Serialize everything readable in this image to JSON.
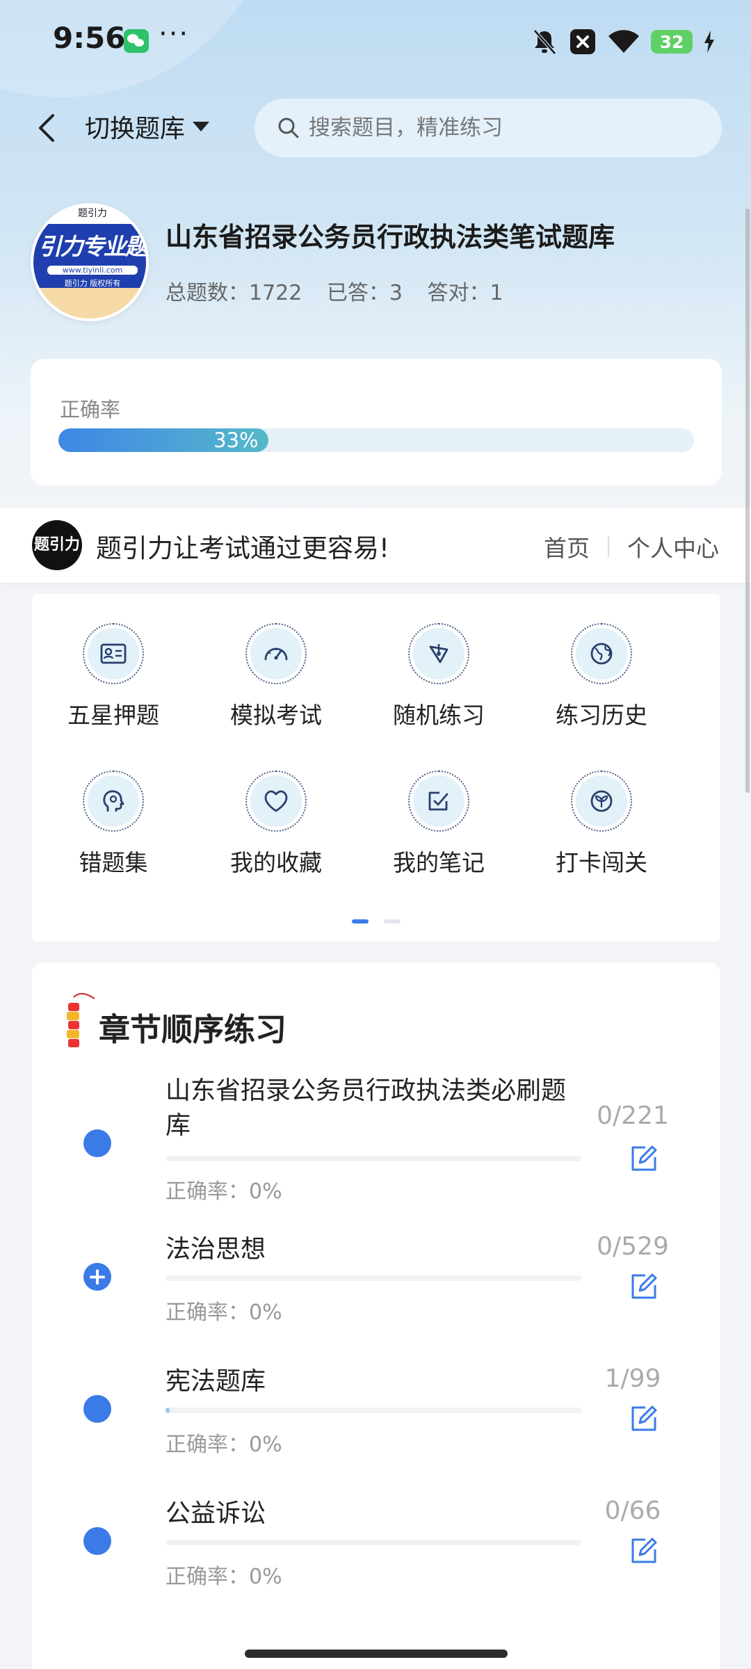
{
  "status_bar": {
    "time": "9:56",
    "more": "···",
    "battery": "32"
  },
  "nav": {
    "switch_label": "切换题库",
    "search_placeholder": "搜索题目，精准练习"
  },
  "bank": {
    "logo_top": "题引力",
    "logo_main": "引力专业题",
    "logo_url": "www.tiyinli.com",
    "logo_sub": "题引力 版权所有",
    "title": "山东省招录公务员行政执法类笔试题库",
    "total_label": "总题数：1722",
    "answered_label": "已答：3",
    "correct_label": "答对：1"
  },
  "accuracy": {
    "label": "正确率",
    "percent_text": "33%",
    "percent": 33
  },
  "slogan": {
    "logo_text": "题引力",
    "text": "题引力让考试通过更容易!",
    "links": [
      "首页",
      "个人中心"
    ]
  },
  "features": [
    {
      "label": "五星押题",
      "icon": "id-card-icon"
    },
    {
      "label": "模拟考试",
      "icon": "gauge-icon"
    },
    {
      "label": "随机练习",
      "icon": "network-icon"
    },
    {
      "label": "练习历史",
      "icon": "globe-icon"
    },
    {
      "label": "错题集",
      "icon": "head-icon"
    },
    {
      "label": "我的收藏",
      "icon": "heart-icon"
    },
    {
      "label": "我的笔记",
      "icon": "note-check-icon"
    },
    {
      "label": "打卡闯关",
      "icon": "sprout-icon"
    }
  ],
  "chapters": {
    "title": "章节顺序练习",
    "items": [
      {
        "name": "山东省招录公务员行政执法类必刷题库",
        "accuracy": "正确率：0%",
        "count": "0/221",
        "progress": 0,
        "expandable": false
      },
      {
        "name": "法治思想",
        "accuracy": "正确率：0%",
        "count": "0/529",
        "progress": 0,
        "expandable": true
      },
      {
        "name": "宪法题库",
        "accuracy": "正确率：0%",
        "count": "1/99",
        "progress": 0.0101,
        "expandable": false
      },
      {
        "name": "公益诉讼",
        "accuracy": "正确率：0%",
        "count": "0/66",
        "progress": 0,
        "expandable": false
      }
    ]
  },
  "colors": {
    "accent": "#3a7be8",
    "progress_start": "#3f86e6",
    "progress_end": "#56b8c9"
  }
}
